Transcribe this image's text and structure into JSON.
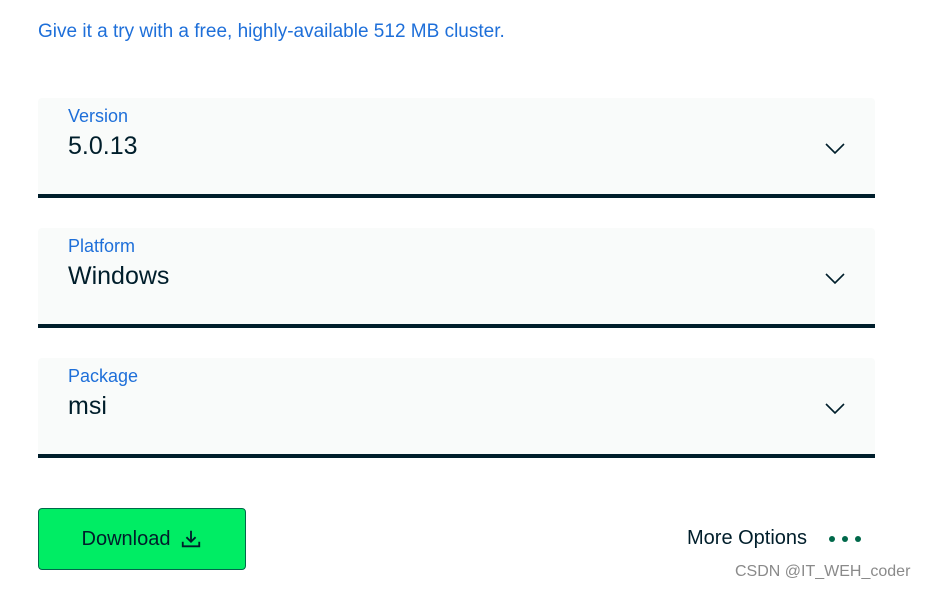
{
  "promo": {
    "text": "Give it a try with a free, highly-available 512 MB cluster.",
    "color": "#1e6fd9"
  },
  "fields": [
    {
      "label": "Version",
      "value": "5.0.13",
      "icon": "chevron-down-icon"
    },
    {
      "label": "Platform",
      "value": "Windows",
      "icon": "chevron-down-icon"
    },
    {
      "label": "Package",
      "value": "msi",
      "icon": "chevron-down-icon"
    }
  ],
  "actions": {
    "download_label": "Download",
    "download_icon": "download-icon",
    "download_color": "#00ed64",
    "more_options_label": "More Options",
    "more_options_icon": "ellipsis-icon"
  },
  "watermark": {
    "text": "CSDN @IT_WEH_coder"
  }
}
